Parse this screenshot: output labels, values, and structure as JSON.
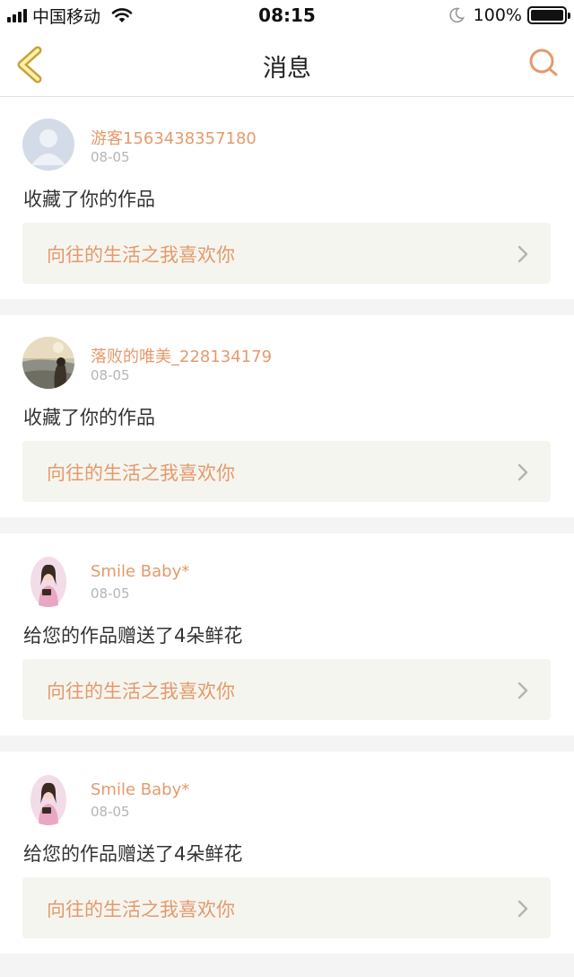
{
  "status_bar": {
    "carrier": "中国移动",
    "time": "08:15",
    "battery": "100%"
  },
  "nav": {
    "title": "消息",
    "back_icon": "chevron-left-icon",
    "search_icon": "search-icon"
  },
  "colors": {
    "accent": "#e49a6c",
    "back_arrow_stroke": "#c9a13c",
    "back_arrow_fill": "#fff3a6",
    "link_bg": "#f5f5ef",
    "page_bg": "#f4f4f4"
  },
  "messages": [
    {
      "username": "游客1563438357180",
      "date": "08-05",
      "action": "收藏了你的作品",
      "work_title": "向往的生活之我喜欢你",
      "avatar": "default-user-avatar"
    },
    {
      "username": "落败的唯美_228134179",
      "date": "08-05",
      "action": "收藏了你的作品",
      "work_title": "向往的生活之我喜欢你",
      "avatar": "landscape-photo-avatar"
    },
    {
      "username": "Smile Baby*",
      "date": "08-05",
      "action": "给您的作品赠送了4朵鲜花",
      "work_title": "向往的生活之我喜欢你",
      "avatar": "girl-photo-avatar"
    },
    {
      "username": "Smile Baby*",
      "date": "08-05",
      "action": "给您的作品赠送了4朵鲜花",
      "work_title": "向往的生活之我喜欢你",
      "avatar": "girl-photo-avatar"
    }
  ]
}
